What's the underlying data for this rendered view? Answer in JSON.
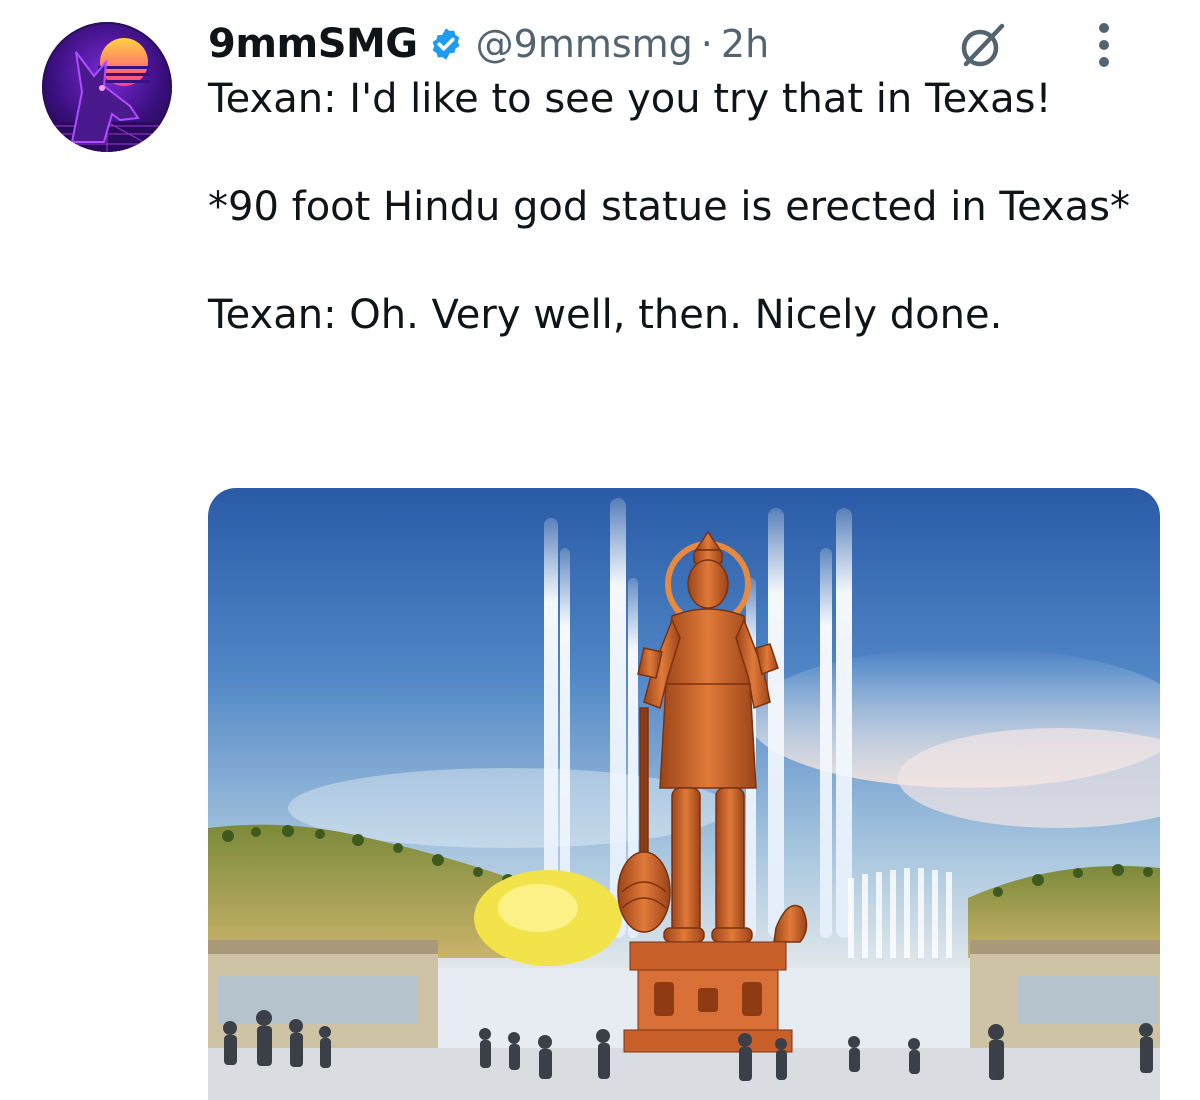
{
  "tweet": {
    "display_name": "9mmSMG",
    "handle": "@9mmsmg",
    "separator": "·",
    "time": "2h",
    "lines": [
      "Texan: I'd like to see you try that in Texas!",
      "*90 foot Hindu god statue is erected in Texas*",
      "Texan: Oh. Very well, then. Nicely done."
    ]
  },
  "icons": {
    "verified": "verified-badge-icon",
    "grok": "grok-icon",
    "more": "more-vertical-icon"
  },
  "colors": {
    "verified_blue": "#1d9bf0",
    "secondary_text": "#536471",
    "primary_text": "#0f1419",
    "statue": "#c8642c"
  }
}
